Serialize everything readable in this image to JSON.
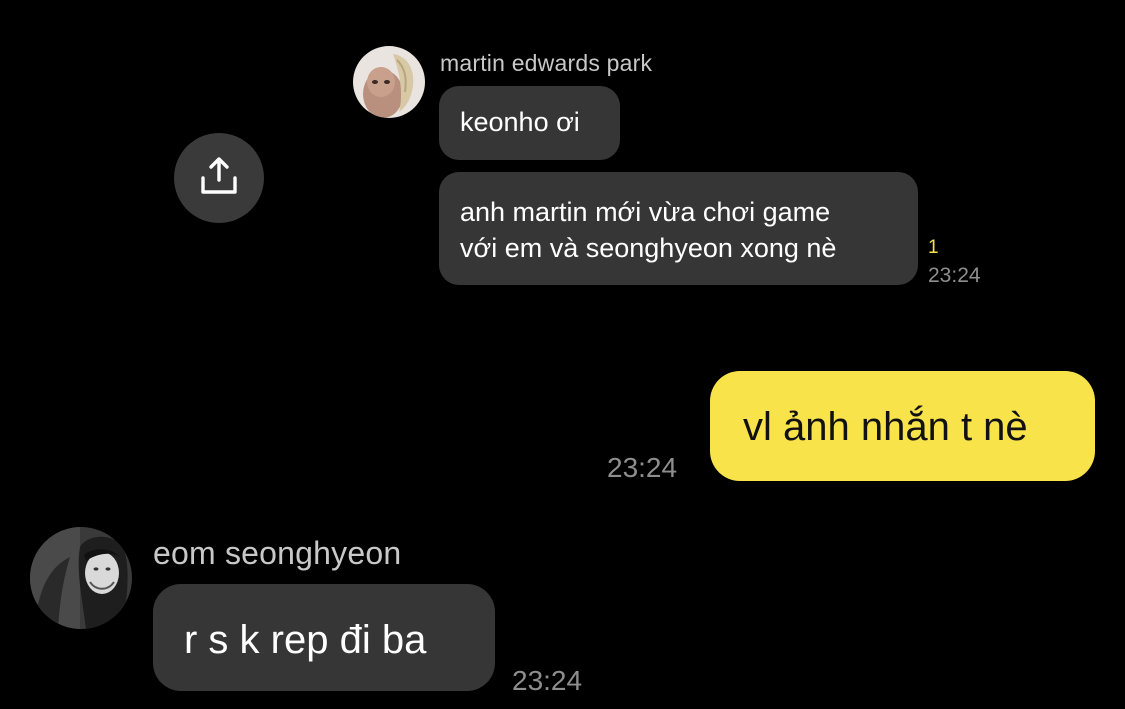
{
  "colors": {
    "background": "#000000",
    "incoming_bubble": "#363636",
    "outgoing_bubble": "#f9e34b",
    "unread_count": "#f5e14a",
    "timestamp": "#8e8e8e",
    "sender_name": "#c8c8c8"
  },
  "share_button": {
    "icon": "share-upload-icon"
  },
  "messages": [
    {
      "sender": "martin edwards park",
      "lines": [
        "keonho ơi"
      ]
    },
    {
      "lines": [
        "anh martin mới vừa chơi game",
        "với em và seonghyeon xong nè"
      ],
      "unread_count": "1",
      "time": "23:24"
    },
    {
      "lines": [
        "vl ảnh nhắn t nè"
      ],
      "time": "23:24"
    },
    {
      "sender": "eom seonghyeon",
      "lines": [
        "r s k rep đi ba"
      ],
      "time": "23:24"
    }
  ]
}
